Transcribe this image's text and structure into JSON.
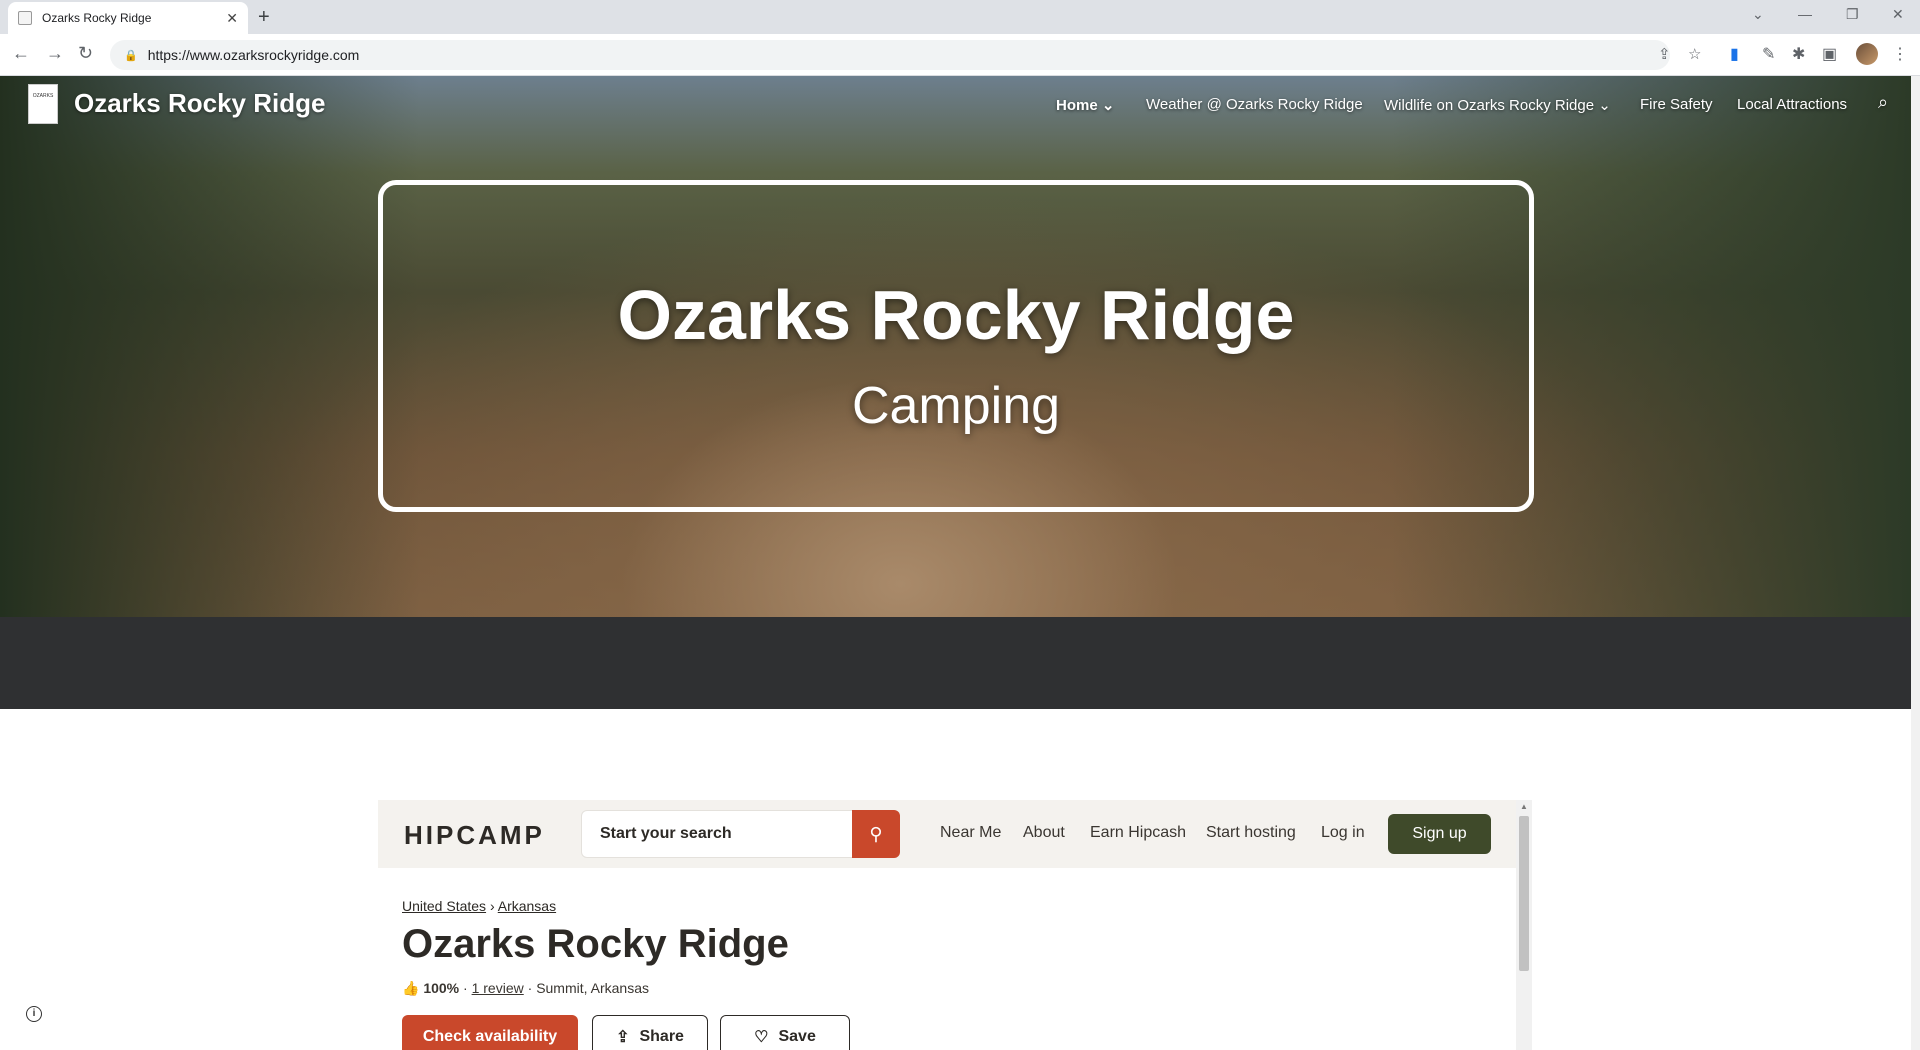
{
  "browser": {
    "tab_title": "Ozarks Rocky Ridge",
    "url": "https://www.ozarksrockyridge.com"
  },
  "site": {
    "logo_text": "OZARKS",
    "title": "Ozarks Rocky Ridge",
    "nav": [
      {
        "label": "Home",
        "active": true,
        "dropdown": true
      },
      {
        "label": "Weather @ Ozarks Rocky Ridge",
        "active": false,
        "dropdown": false
      },
      {
        "label": "Wildlife on Ozarks Rocky Ridge",
        "active": false,
        "dropdown": true
      },
      {
        "label": "Fire Safety",
        "active": false,
        "dropdown": false
      },
      {
        "label": "Local Attractions",
        "active": false,
        "dropdown": false
      }
    ]
  },
  "hero": {
    "title": "Ozarks Rocky Ridge",
    "subtitle": "Camping"
  },
  "hipcamp": {
    "logo": "HIPCAMP",
    "search_placeholder": "Start your search",
    "nav": [
      "Near Me",
      "About",
      "Earn Hipcash",
      "Start hosting",
      "Log in"
    ],
    "signup": "Sign up",
    "breadcrumb": [
      "United States",
      "Arkansas"
    ],
    "listing_title": "Ozarks Rocky Ridge",
    "rating": "100%",
    "reviews": "1 review",
    "location": "Summit, Arkansas",
    "buttons": {
      "check": "Check availability",
      "share": "Share",
      "save": "Save"
    },
    "accent_color": "#c9482b",
    "signup_color": "#3f4a2a"
  }
}
